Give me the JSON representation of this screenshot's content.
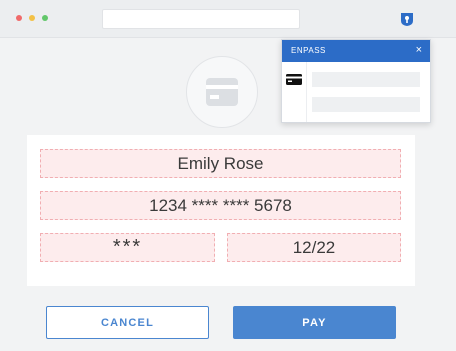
{
  "browser": {
    "window_controls": [
      "close",
      "minimize",
      "maximize"
    ],
    "extension_icon": "enpass-keyhole-icon"
  },
  "avatar": {
    "icon": "credit-card-icon"
  },
  "card_form": {
    "name_value": "Emily Rose",
    "number_value": "1234 **** **** 5678",
    "cvv_value": "***",
    "expiry_value": "12/22"
  },
  "buttons": {
    "cancel_label": "CANCEL",
    "pay_label": "PAY"
  },
  "enpass_popup": {
    "title": "ENPASS",
    "close_label": "×",
    "item_icon": "credit-card-icon"
  },
  "colors": {
    "accent": "#4a86d0",
    "popup_header": "#2c6cc7",
    "autofill_field_bg": "#fdeced",
    "autofill_field_border": "#f1aeb2"
  }
}
